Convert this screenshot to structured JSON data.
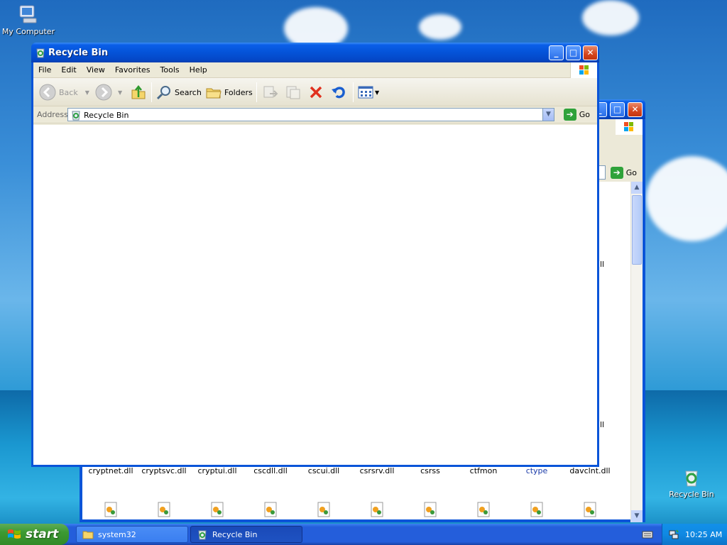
{
  "desktop": {
    "icons": [
      {
        "label": "My Computer"
      },
      {
        "label": "Recycle Bin"
      }
    ]
  },
  "back_window": {
    "go_label": "Go",
    "partial_labels": [
      "dll",
      "dll"
    ],
    "files_row1": [
      "cryptnet.dll",
      "cryptsvc.dll",
      "cryptui.dll",
      "cscdll.dll",
      "cscui.dll",
      "csrsrv.dll",
      "csrss",
      "ctfmon",
      "ctype",
      "davclnt.dll"
    ]
  },
  "window": {
    "title": "Recycle Bin",
    "menu": [
      "File",
      "Edit",
      "View",
      "Favorites",
      "Tools",
      "Help"
    ],
    "toolbar": {
      "back_label": "Back",
      "search_label": "Search",
      "folders_label": "Folders"
    },
    "address": {
      "label": "Address",
      "value": "Recycle Bin",
      "go_label": "Go"
    }
  },
  "taskbar": {
    "start_label": "start",
    "tasks": [
      {
        "label": "system32"
      },
      {
        "label": "Recycle Bin"
      }
    ],
    "clock": "10:25 AM"
  },
  "colors": {
    "title_blue": "#0453d8",
    "taskbar_blue": "#245edb",
    "start_green": "#3c9a32"
  }
}
